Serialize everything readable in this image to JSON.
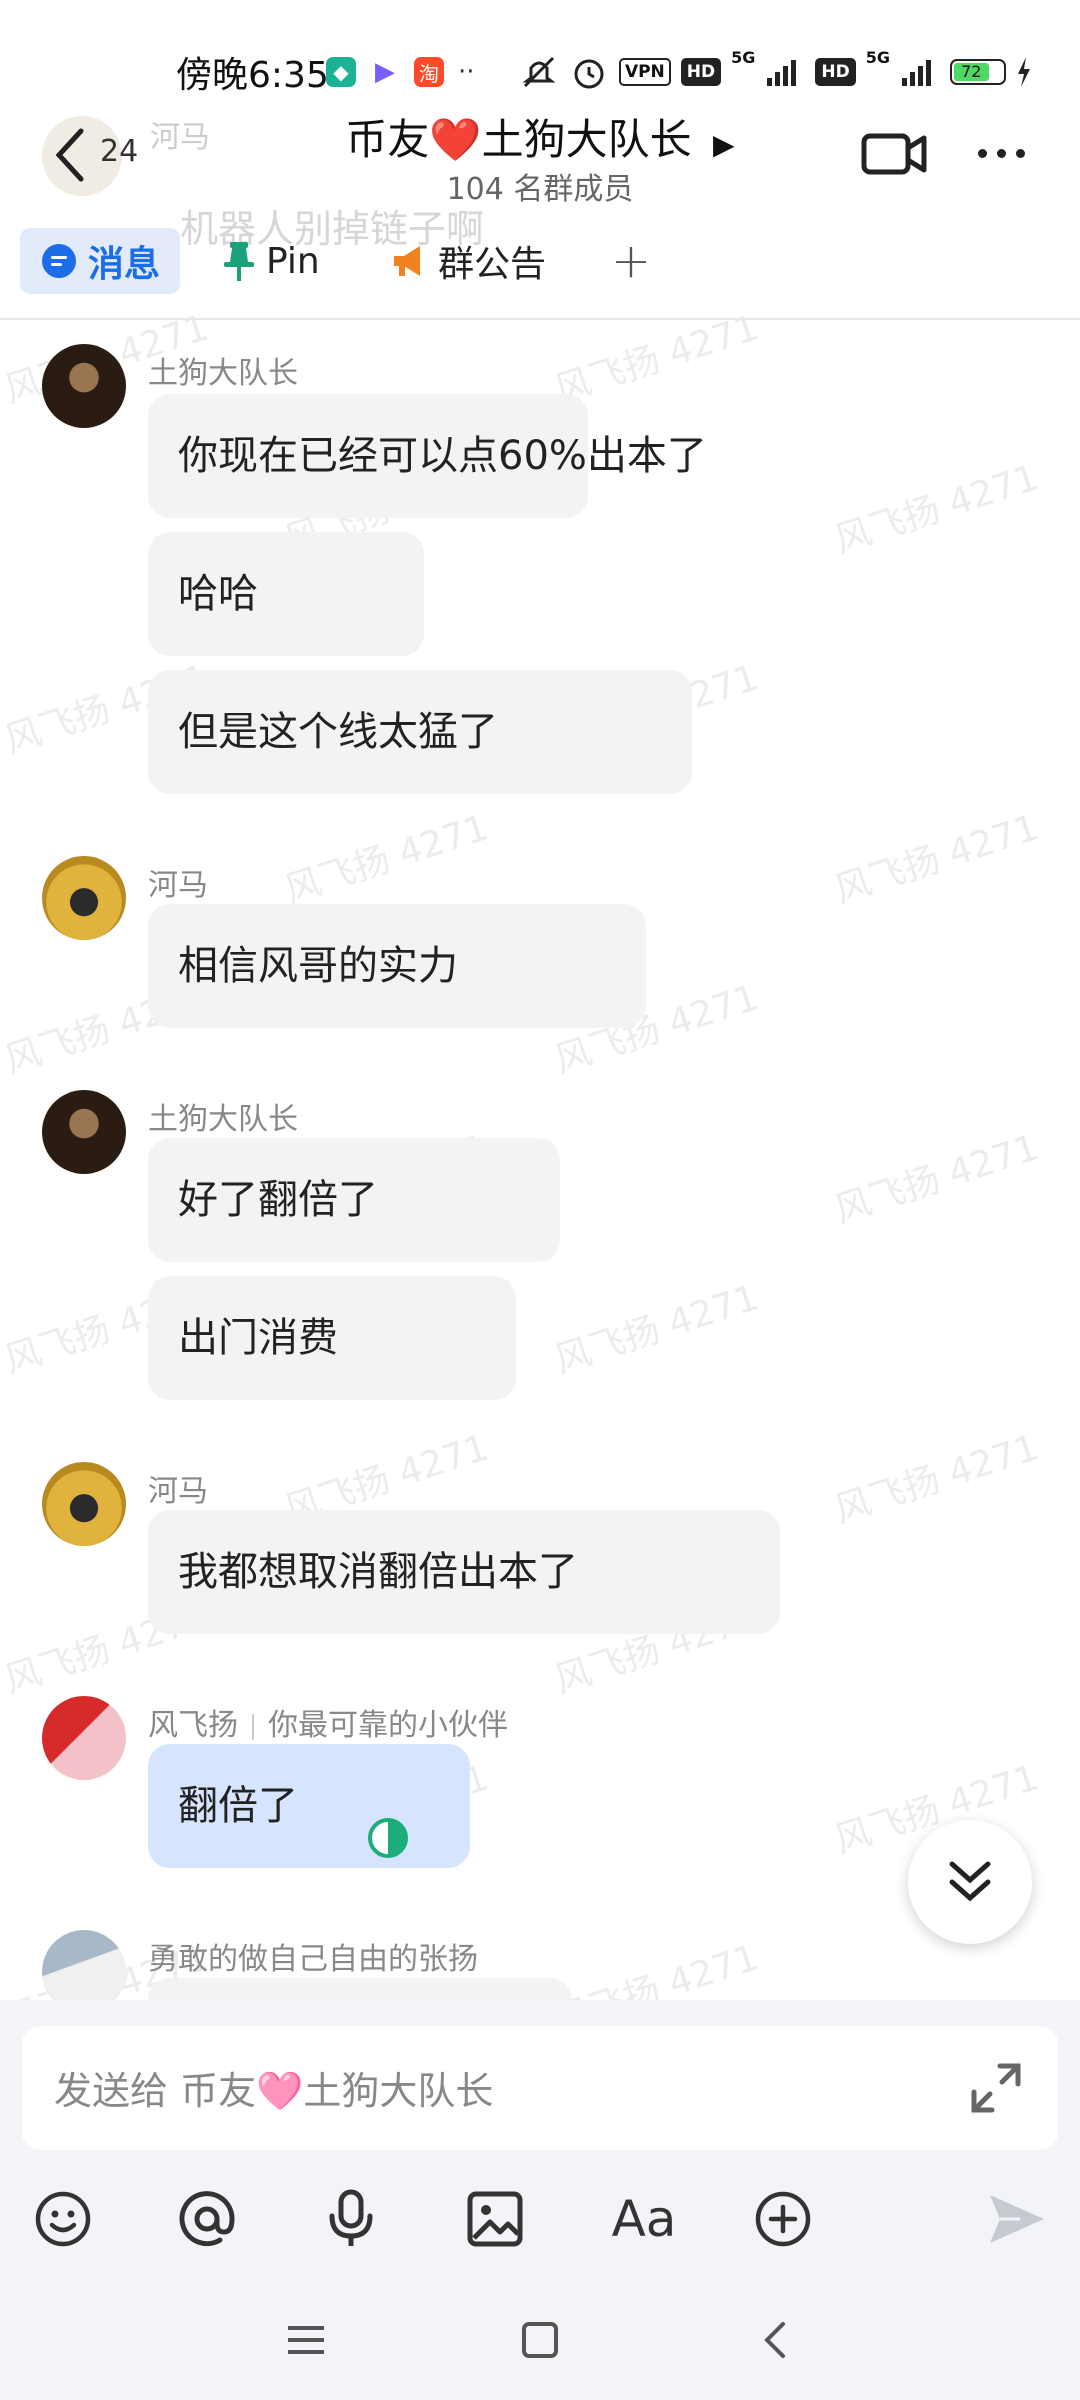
{
  "status_bar": {
    "time": "傍晚6:35",
    "dots": "··",
    "vpn": "VPN",
    "hd1": "HD",
    "sig1": "5G",
    "hd2": "HD",
    "sig2": "5G",
    "battery": "72",
    "battery_level": 0.72,
    "app_taobao": "淘"
  },
  "header": {
    "unread_count": "24",
    "title": "币友❤️土狗大队长",
    "member_count": "104 名群成员",
    "ghost_text": "机器人别掉链子啊",
    "ghost_name": "河马"
  },
  "tabs": [
    {
      "label": "消息",
      "icon": "message-icon"
    },
    {
      "label": "Pin",
      "icon": "pin-icon"
    },
    {
      "label": "群公告",
      "icon": "megaphone-icon"
    }
  ],
  "tab_add": "+",
  "messages": [
    {
      "sender": "土狗大队长",
      "bubbles": [
        "你现在已经可以点60%出本了",
        "哈哈",
        "但是这个线太猛了"
      ]
    },
    {
      "sender": "河马",
      "bubbles": [
        "相信风哥的实力"
      ]
    },
    {
      "sender": "土狗大队长",
      "bubbles": [
        "好了翻倍了",
        "出门消费"
      ]
    },
    {
      "sender": "河马",
      "bubbles": [
        "我都想取消翻倍出本了"
      ]
    },
    {
      "sender": "风飞扬",
      "title": "你最可靠的小伙伴",
      "bubbles": [
        "翻倍了"
      ]
    },
    {
      "sender": "勇敢的做自己自由的张扬",
      "bubbles": []
    }
  ],
  "watermark": "风飞扬 4271",
  "input": {
    "placeholder": "发送给 币友🩷土狗大队长"
  },
  "tools": [
    "emoji-icon",
    "mention-icon",
    "microphone-icon",
    "image-icon",
    "text-format-icon",
    "plus-circle-icon",
    "send-icon"
  ],
  "text_format_label": "Aa",
  "colors": {
    "accent": "#1b6de8",
    "bubble_other": "#f2f3f5",
    "bubble_mine": "#d6e4fd",
    "read_indicator": "#1cae7a"
  }
}
